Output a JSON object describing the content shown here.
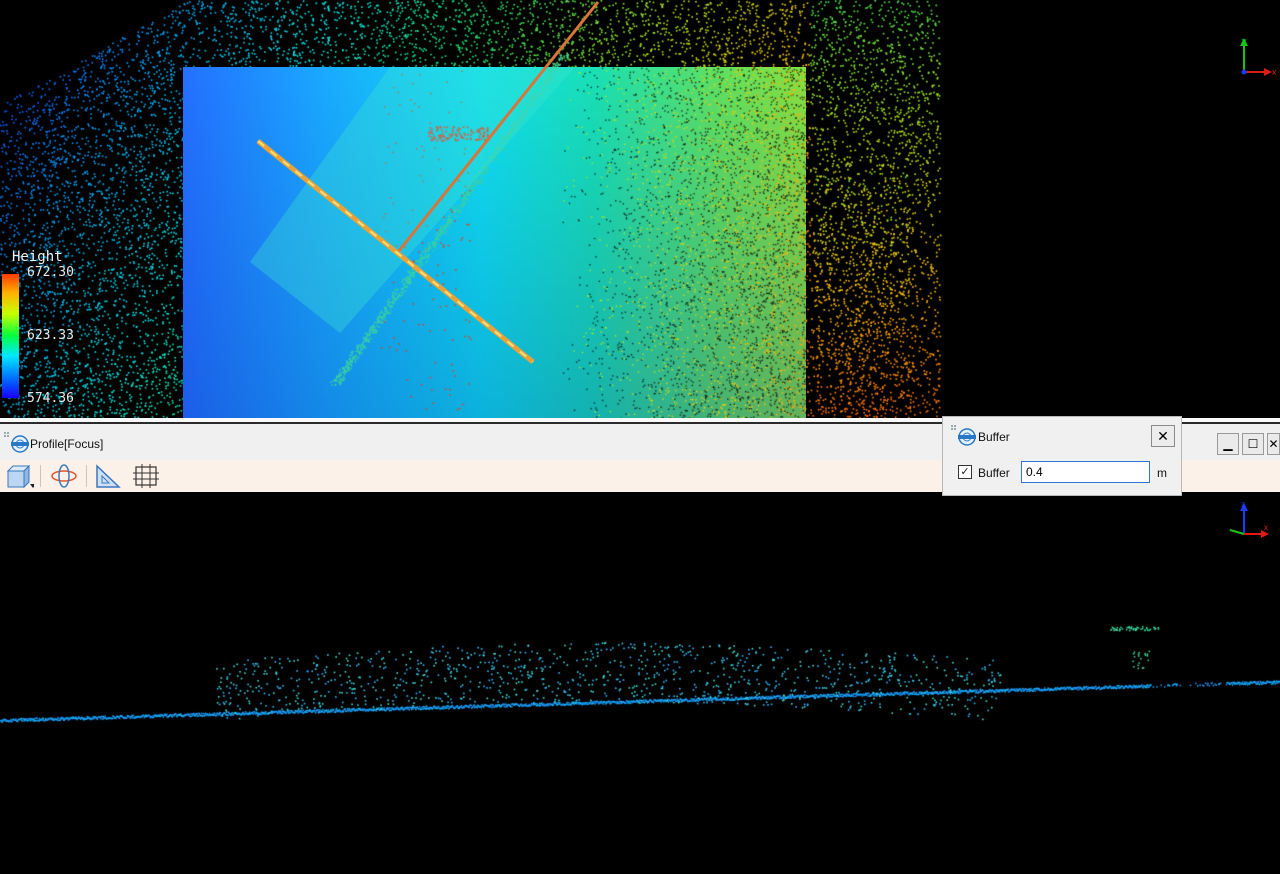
{
  "view3d": {
    "legend": {
      "title": "Height",
      "max": "672.30",
      "mid": "623.33",
      "min": "574.36"
    },
    "axis_labels": {
      "x": "x",
      "y": "y"
    }
  },
  "profile": {
    "title": "Profile[Focus]",
    "axis_labels": {
      "x": "x",
      "z": "z"
    }
  },
  "buffer_dialog": {
    "title": "Buffer",
    "checkbox_label": "Buffer",
    "checked": true,
    "value": "0.4",
    "unit": "m"
  },
  "colors": {
    "measure_line": "#e8a23a",
    "dialog_bg": "#f0f0f0",
    "toolbar_bg": "#fbf1e8",
    "input_border": "#2b79d8"
  },
  "icons": [
    "app-logo-icon",
    "cube-view-icon",
    "orbit-icon",
    "ruler-triangle-icon",
    "grid-select-icon",
    "minimize-icon",
    "maximize-icon",
    "close-icon"
  ]
}
